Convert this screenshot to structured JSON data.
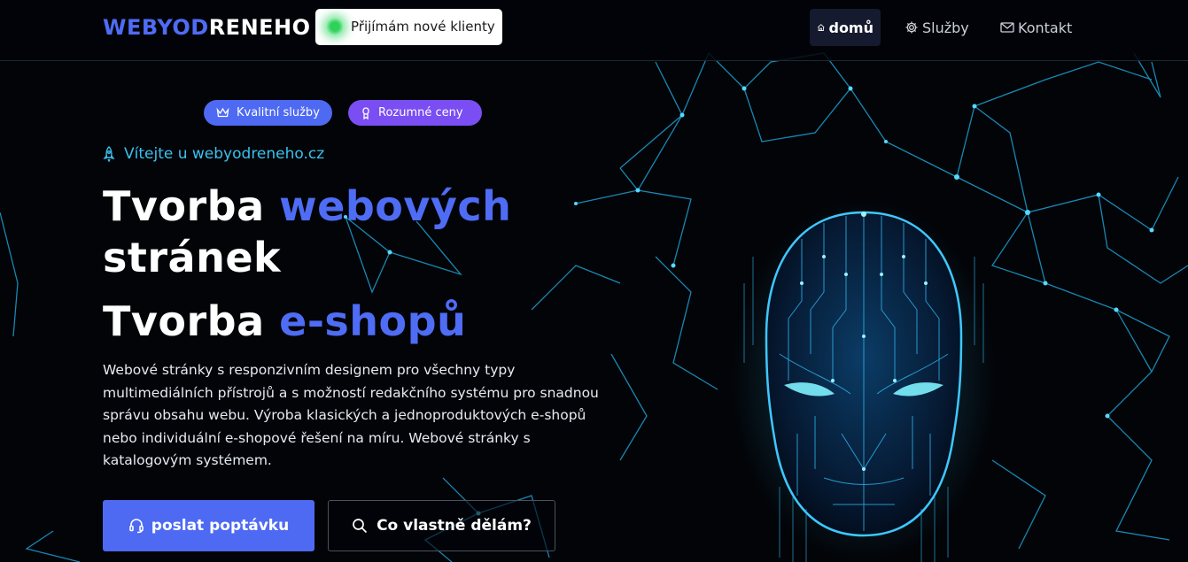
{
  "header": {
    "logo_part1": "WEBYOD",
    "logo_part2": "RENEHO",
    "status_badge": "Přijímám nové klienty",
    "nav": [
      {
        "label": "domů",
        "icon": "home-icon",
        "active": true
      },
      {
        "label": "Služby",
        "icon": "gear-icon",
        "active": false
      },
      {
        "label": "Kontakt",
        "icon": "envelope-icon",
        "active": false
      }
    ]
  },
  "hero": {
    "pills": [
      {
        "label": "Kvalitní služby",
        "icon": "crown-icon"
      },
      {
        "label": "Rozumné ceny",
        "icon": "award-icon"
      }
    ],
    "welcome": "Vítejte u webyodreneho.cz",
    "headline1_plain": "Tvorba ",
    "headline1_accent": "webových",
    "headline1_line2": "stránek",
    "headline2_plain": "Tvorba ",
    "headline2_accent": "e-shopů",
    "description": "Webové stránky s responzivním designem pro všechny typy multimediálních přístrojů a s možností redakčního systému pro snadnou správu obsahu webu. Výroba klasických a jednoproduktových e-shopů nebo individuální e-shopové řešení na míru. Webové stránky s katalogovým systémem.",
    "primary_button": "poslat poptávku",
    "secondary_button": "Co vlastně dělám?"
  },
  "colors": {
    "accent": "#4f6cf5",
    "purple": "#7a4ef2",
    "cyan": "#3bc0ee",
    "background": "#020408"
  }
}
